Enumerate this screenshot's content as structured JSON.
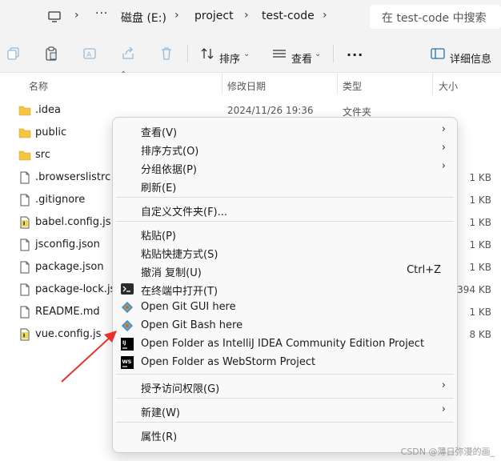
{
  "address_bar": {
    "ellipsis": "···",
    "crumbs": [
      "磁盘 (E:)",
      "project",
      "test-code"
    ],
    "search_placeholder": "在 test-code 中搜索"
  },
  "toolbar": {
    "sort_label": "排序",
    "view_label": "查看",
    "more_label": "···",
    "details_label": "详细信息"
  },
  "columns": {
    "name": "名称",
    "date": "修改日期",
    "type": "类型",
    "size": "大小"
  },
  "files": [
    {
      "name": ".idea",
      "date": "2024/11/26 19:36",
      "type": "文件夹",
      "size": "",
      "icon": "folder-icon"
    },
    {
      "name": "public",
      "date": "",
      "type": "",
      "size": "",
      "icon": "folder-icon"
    },
    {
      "name": "src",
      "date": "",
      "type": "",
      "size": "",
      "icon": "folder-icon"
    },
    {
      "name": ".browserslistrc",
      "date": "",
      "type": "",
      "size": "1 KB",
      "icon": "file-icon"
    },
    {
      "name": ".gitignore",
      "date": "",
      "type": "",
      "size": "1 KB",
      "icon": "file-icon"
    },
    {
      "name": "babel.config.js",
      "date": "",
      "type": "",
      "size": "1 KB",
      "icon": "js-file-icon"
    },
    {
      "name": "jsconfig.json",
      "date": "",
      "type": "",
      "size": "1 KB",
      "icon": "file-icon"
    },
    {
      "name": "package.json",
      "date": "",
      "type": "",
      "size": "1 KB",
      "icon": "file-icon"
    },
    {
      "name": "package-lock.jso",
      "date": "",
      "type": "",
      "size": "394 KB",
      "icon": "file-icon"
    },
    {
      "name": "README.md",
      "date": "",
      "type": "",
      "size": "1 KB",
      "icon": "file-icon"
    },
    {
      "name": "vue.config.js",
      "date": "",
      "type": "",
      "size": "8 KB",
      "icon": "js-file-icon"
    }
  ],
  "context_menu": {
    "view": "查看(V)",
    "sort_by": "排序方式(O)",
    "group_by": "分组依据(P)",
    "refresh": "刷新(E)",
    "customize_folder": "自定义文件夹(F)...",
    "paste": "粘贴(P)",
    "paste_shortcut": "粘贴快捷方式(S)",
    "undo_copy": "撤消 复制(U)",
    "undo_shortcut": "Ctrl+Z",
    "open_in_terminal": "在终端中打开(T)",
    "git_gui": "Open Git GUI here",
    "git_bash": "Open Git Bash here",
    "intellij": "Open Folder as IntelliJ IDEA Community Edition Project",
    "webstorm": "Open Folder as WebStorm Project",
    "grant_access": "授予访问权限(G)",
    "new": "新建(W)",
    "properties": "属性(R)"
  },
  "colors": {
    "arrow": "#e8302c",
    "folder": "#f4c542",
    "git": "#f05133"
  },
  "watermark": "CSDN @薄日弥漫的画_"
}
